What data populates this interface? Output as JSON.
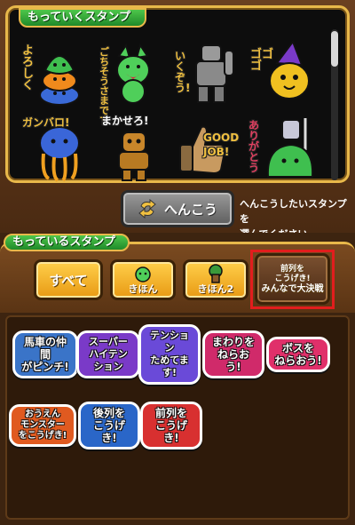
{
  "carry": {
    "title": "もっていくスタンプ",
    "stamps": [
      {
        "word": "よろしく",
        "icon": "slime-stack-icon",
        "color": "#3fbf4f"
      },
      {
        "word": "ごちそうさまです",
        "icon": "green-creature-icon",
        "color": "#4fcf5a"
      },
      {
        "word": "いくぞう!",
        "icon": "golem-statue-icon",
        "color": "#9a9a9a"
      },
      {
        "word": "ゴゴゴ",
        "icon": "wizard-blob-icon",
        "color": "#f0c020"
      },
      {
        "word": "ガンバロ!",
        "icon": "healslime-icon",
        "color": "#3a66d8"
      },
      {
        "word": "まかせろ!",
        "icon": "mummy-icon",
        "color": "#c8862a"
      },
      {
        "word": "GOOD JOB!",
        "icon": "thumbs-up-icon",
        "color": "#8a6a40"
      },
      {
        "word": "ありがとう",
        "icon": "slime-knight-icon",
        "color": "#3fbf4f"
      }
    ]
  },
  "change": {
    "label": "へんこう",
    "hint_line1": "へんこうしたいスタンプを",
    "hint_line2": "選んでください"
  },
  "owned": {
    "title": "もっているスタンプ",
    "tabs": [
      {
        "label": "すべて"
      },
      {
        "label": "きほん"
      },
      {
        "label": "きほん2"
      },
      {
        "line1": "前列を",
        "line2": "こうげき!",
        "line3": "みんなで大決戦"
      }
    ],
    "stamps": [
      {
        "line1": "馬車の仲間",
        "line2": "がピンチ!",
        "color": "#3a74c8"
      },
      {
        "line1": "スーパー",
        "line2": "ハイテンション",
        "color": "#7a3ac8"
      },
      {
        "line1": "テンション",
        "line2": "ためてます!",
        "color": "#6a4ad8"
      },
      {
        "line1": "まわりを",
        "line2": "ねらおう!",
        "color": "#d02a6a"
      },
      {
        "line1": "ボスを",
        "line2": "ねらおう!",
        "color": "#e0306a"
      },
      {
        "line1": "おうえん",
        "line2": "モンスターをこうげき!",
        "color": "#e05a20"
      },
      {
        "line1": "後列を",
        "line2": "こうげき!",
        "color": "#2a66c8"
      },
      {
        "line1": "前列を",
        "line2": "こうげき!",
        "color": "#d83030"
      }
    ]
  }
}
